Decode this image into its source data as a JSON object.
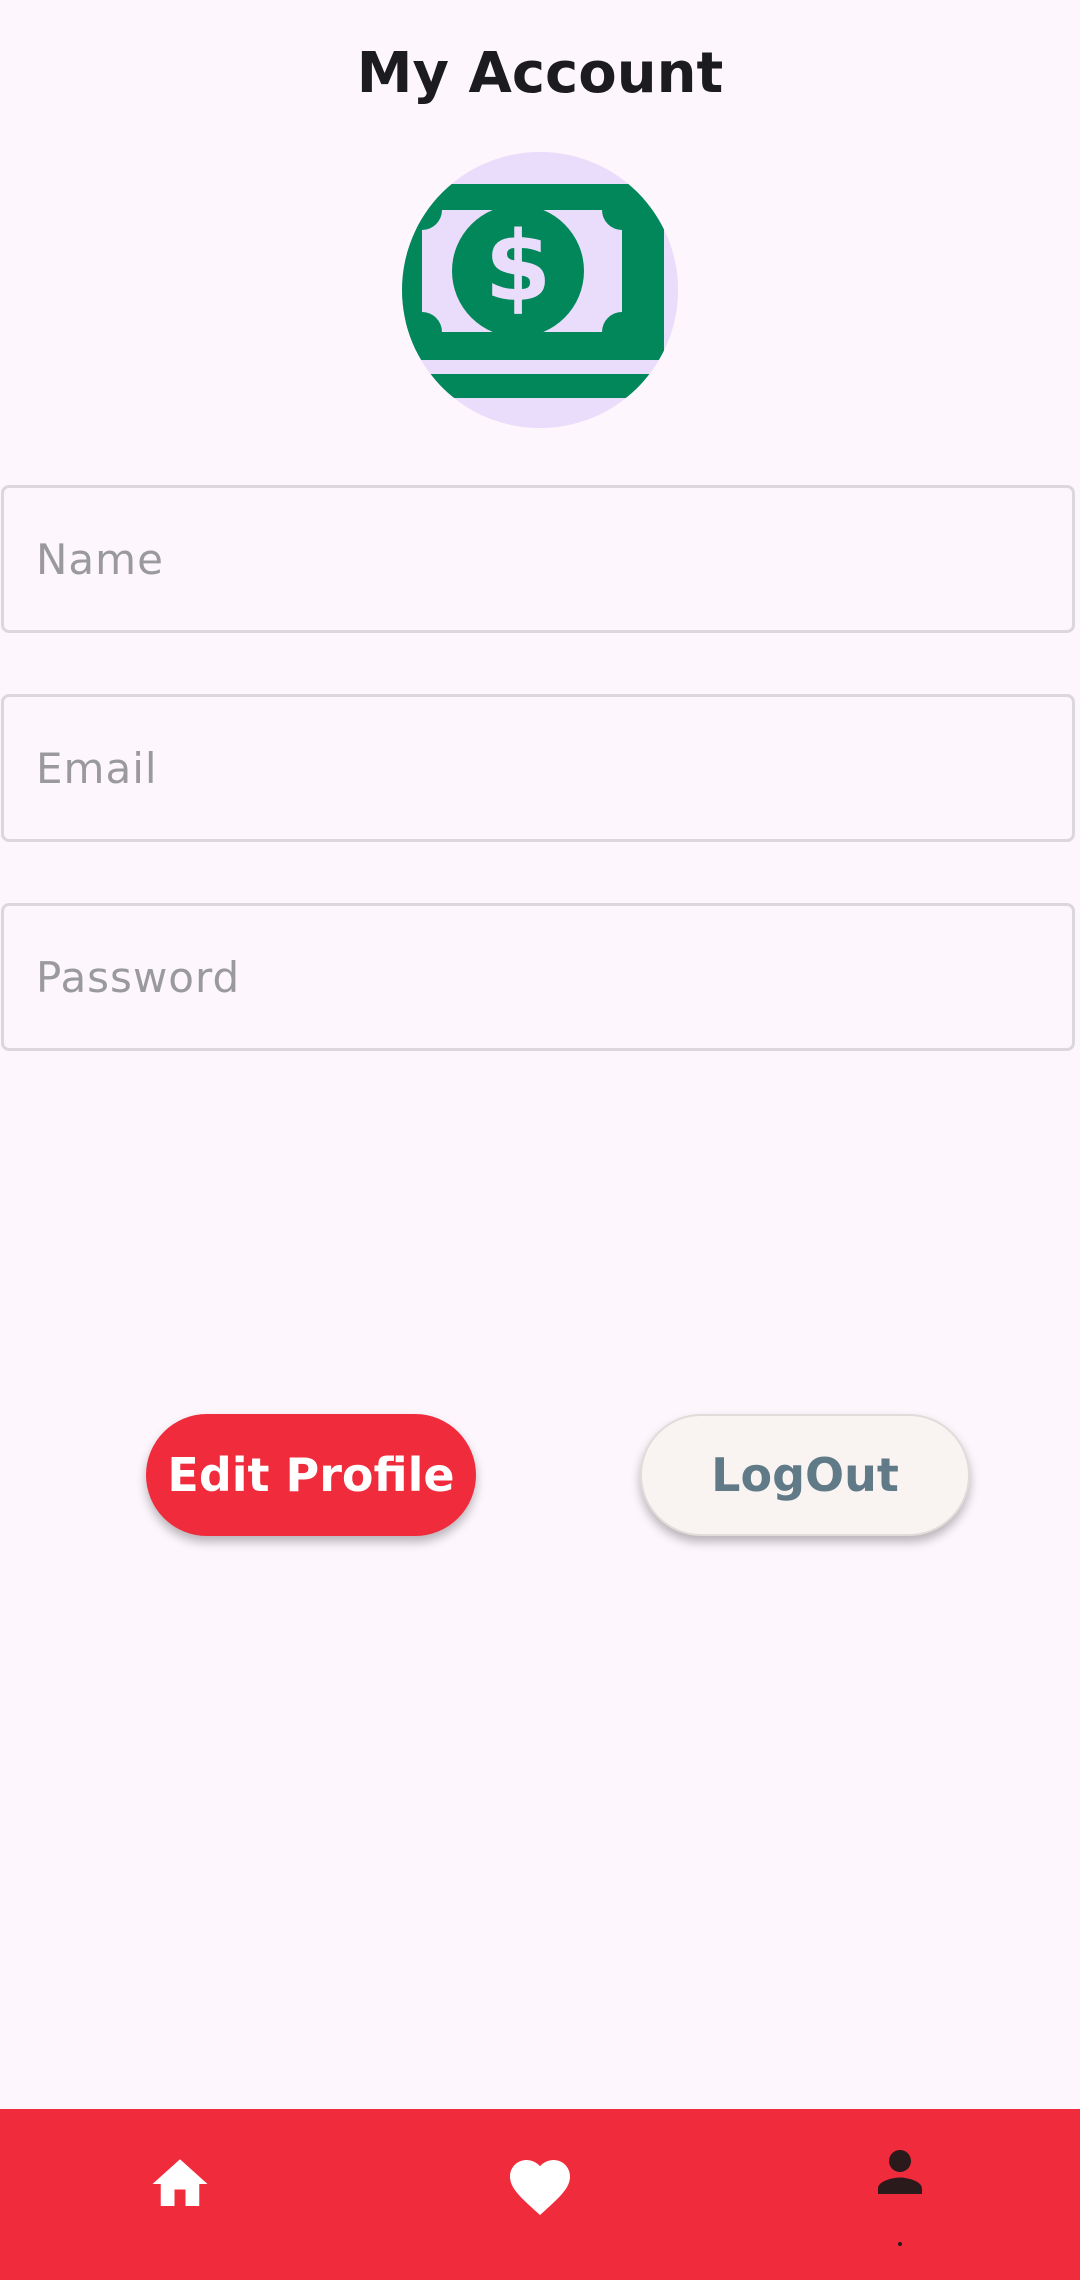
{
  "header": {
    "title": "My Account"
  },
  "avatar": {
    "icon": "money-bill-icon",
    "colors": {
      "background": "#e9ddfb",
      "bill": "#01875a"
    }
  },
  "form": {
    "name_placeholder": "Name",
    "name_value": "",
    "email_placeholder": "Email",
    "email_value": "",
    "password_placeholder": "Password",
    "password_value": ""
  },
  "actions": {
    "edit_label": "Edit Profile",
    "logout_label": "LogOut"
  },
  "bottom_nav": {
    "items": [
      {
        "icon": "home-icon",
        "active": false
      },
      {
        "icon": "heart-icon",
        "active": false
      },
      {
        "icon": "person-icon",
        "active": true
      }
    ]
  },
  "colors": {
    "accent": "#f02b3c",
    "background": "#fdf7fd",
    "logout_text": "#617a88",
    "field_border": "#dcd7dd",
    "placeholder": "#9a9a9d"
  }
}
